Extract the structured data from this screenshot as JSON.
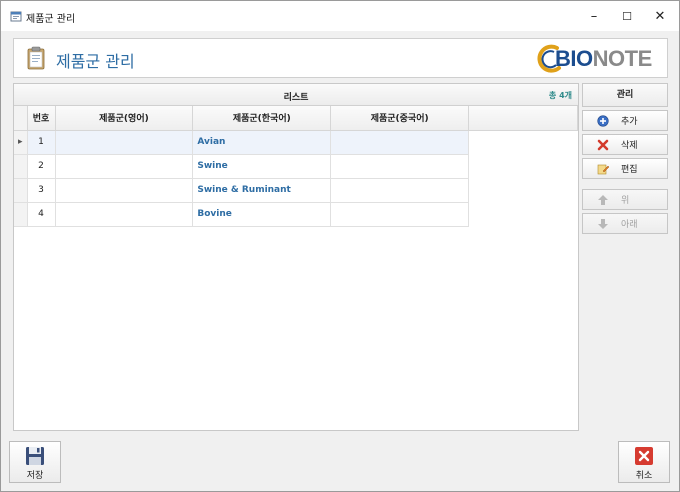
{
  "window": {
    "title": "제품군 관리",
    "minimize": "–",
    "maximize": "☐",
    "close": "✕"
  },
  "header": {
    "title": "제품군 관리",
    "logo_main": "BIO",
    "logo_accent": "NOTE",
    "icon": "clipboard-icon"
  },
  "list": {
    "title": "리스트",
    "count": "총 4개",
    "columns": [
      "번호",
      "제품군(영어)",
      "제품군(한국어)",
      "제품군(중국어)"
    ],
    "rows": [
      {
        "no": "1",
        "eng": "",
        "kor": "Avian",
        "chn": ""
      },
      {
        "no": "2",
        "eng": "",
        "kor": "Swine",
        "chn": ""
      },
      {
        "no": "3",
        "eng": "",
        "kor": "Swine & Ruminant",
        "chn": ""
      },
      {
        "no": "4",
        "eng": "",
        "kor": "Bovine",
        "chn": ""
      }
    ],
    "selected_marker": "▸"
  },
  "actions": {
    "title": "관리",
    "add": "추가",
    "delete": "삭제",
    "edit": "편집",
    "up": "위",
    "down": "아래"
  },
  "footer": {
    "save": "저장",
    "cancel": "취소"
  },
  "colors": {
    "accent": "#2e6da4",
    "add_icon": "#3b6fc4",
    "delete_icon": "#d33a2c",
    "cancel_icon": "#d63b30",
    "save_icon": "#3a4f7a"
  }
}
